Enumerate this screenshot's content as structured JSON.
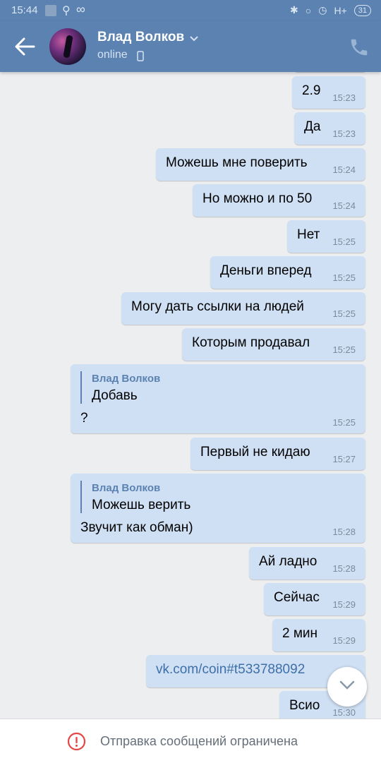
{
  "status_bar": {
    "time": "15:44",
    "network": "H+",
    "battery": "31"
  },
  "header": {
    "contact_name": "Влад Волков",
    "status": "online",
    "accent": "#5b82b1"
  },
  "messages": [
    {
      "text": "2.9",
      "time": "15:23"
    },
    {
      "text": "Да",
      "time": "15:23"
    },
    {
      "text": "Можешь мне поверить",
      "time": "15:24"
    },
    {
      "text": "Но можно и по 50",
      "time": "15:24"
    },
    {
      "text": "Нет",
      "time": "15:25"
    },
    {
      "text": "Деньги вперед",
      "time": "15:25"
    },
    {
      "text": "Могу дать ссылки на людей",
      "time": "15:25"
    },
    {
      "text": "Которым продавал",
      "time": "15:25"
    },
    {
      "quote_name": "Влад Волков",
      "quote_text": "Добавь",
      "text": "?",
      "time": "15:25"
    },
    {
      "text": "Первый не кидаю",
      "time": "15:27"
    },
    {
      "quote_name": "Влад Волков",
      "quote_text": "Можешь верить",
      "text": "Звучит как обман)",
      "time": "15:28"
    },
    {
      "text": "Ай ладно",
      "time": "15:28"
    },
    {
      "text": "Сейчас",
      "time": "15:29"
    },
    {
      "text": "2 мин",
      "time": "15:29"
    },
    {
      "text": "vk.com/coin#t533788092",
      "time": "",
      "is_link": true
    },
    {
      "text": "Всио",
      "time": "15:30"
    }
  ],
  "bottom_bar": {
    "restriction_text": "Отправка сообщений ограничена"
  },
  "icons": {
    "back": "arrow-left-icon",
    "phone": "phone-icon",
    "scroll": "chevron-down-icon",
    "warning": "exclamation-circle-icon"
  }
}
